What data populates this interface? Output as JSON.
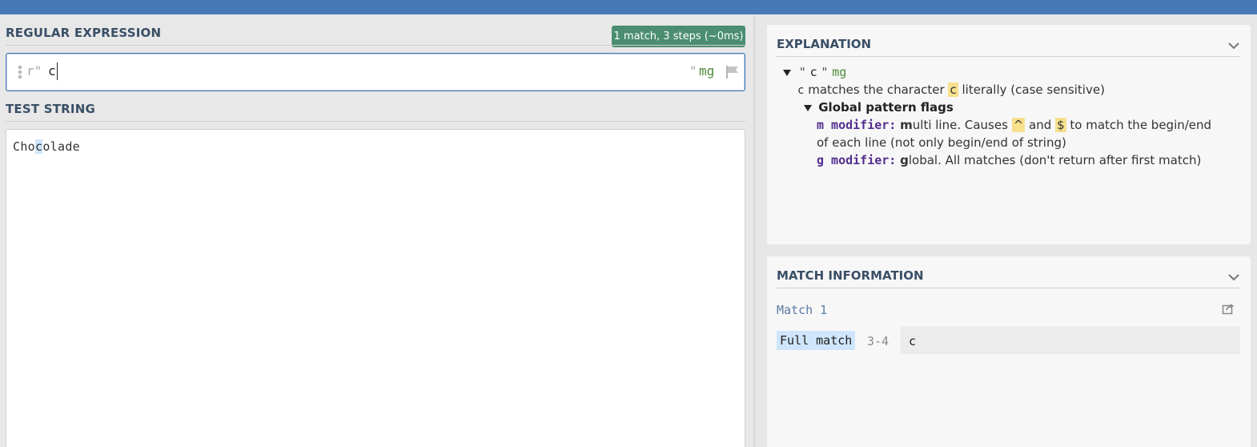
{
  "regex_panel": {
    "title": "REGULAR EXPRESSION",
    "status_badge": "1 match, 3 steps (~0ms)",
    "delimiter_open": "r\"",
    "pattern": "c",
    "delimiter_close": "\"",
    "flags": "mg"
  },
  "test_panel": {
    "title": "TEST STRING",
    "text_before": "Cho",
    "text_match": "c",
    "text_after": "olade"
  },
  "explanation": {
    "title": "EXPLANATION",
    "root": {
      "open_quote": "\"",
      "pattern": "c",
      "close_quote": "\"",
      "flags": "mg"
    },
    "token_line": {
      "token": "c",
      "text_before": "matches the character",
      "char": "c",
      "text_after": "literally (case sensitive)"
    },
    "flags_heading": "Global pattern flags",
    "m_flag": {
      "label": "m modifier:",
      "first_letter": "m",
      "rest": "ulti line. Causes",
      "caret": "^",
      "and": "and",
      "dollar": "$",
      "end_line1": "to match the begin/end",
      "line2": "of each line (not only begin/end of string)"
    },
    "g_flag": {
      "label": "g modifier:",
      "first_letter": "g",
      "rest": "lobal. All matches (don't return after first match)"
    }
  },
  "match_info": {
    "title": "MATCH INFORMATION",
    "match_label": "Match 1",
    "full_match_label": "Full match",
    "range": "3-4",
    "value": "c"
  },
  "icons": {
    "flag": "flag-icon",
    "share": "share-icon",
    "chevron": "chevron-down-icon"
  },
  "colors": {
    "topbar": "#4779b8",
    "badge": "#4b8e72",
    "flags": "#4d8a3a",
    "modifier": "#532e8f",
    "match_highlight": "#cfe5fb",
    "token_highlight": "#f8e18d"
  }
}
